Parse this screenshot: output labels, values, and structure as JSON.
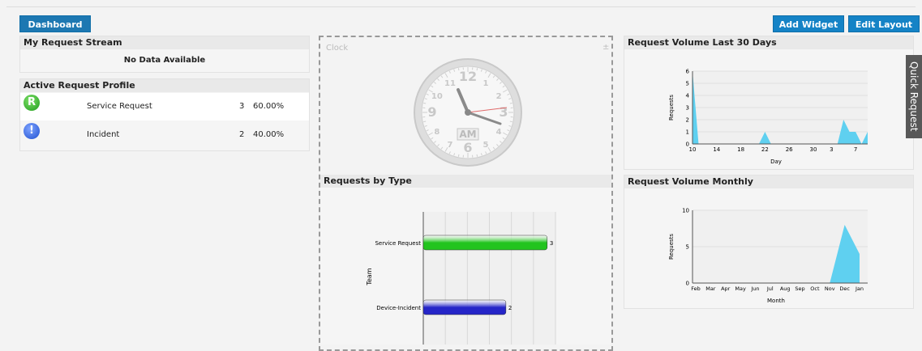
{
  "toolbar": {
    "dashboard": "Dashboard",
    "add_widget": "Add Widget",
    "edit_layout": "Edit Layout"
  },
  "quick_request": "Quick Request",
  "stream": {
    "title": "My Request Stream",
    "empty": "No Data Available"
  },
  "profile": {
    "title": "Active Request Profile",
    "rows": [
      {
        "icon": "R",
        "name": "Service Request",
        "count": "3",
        "percent": "60.00%"
      },
      {
        "icon": "!",
        "name": "Incident",
        "count": "2",
        "percent": "40.00%"
      }
    ]
  },
  "clock": {
    "title": "Clock",
    "ampm": "AM",
    "numerals": [
      "12",
      "1",
      "2",
      "3",
      "4",
      "5",
      "6",
      "7",
      "8",
      "9",
      "10",
      "11"
    ]
  },
  "by_type": {
    "title": "Requests by Type"
  },
  "vol30": {
    "title": "Request Volume Last 30 Days"
  },
  "monthly": {
    "title": "Request Volume Monthly"
  },
  "chart_data": [
    {
      "type": "bar",
      "title": "Requests by Type",
      "ylabel": "Team",
      "categories": [
        "Service Request",
        "Device-Incident"
      ],
      "values": [
        3,
        2
      ],
      "colors": [
        "#22c41e",
        "#2525c8"
      ]
    },
    {
      "type": "area",
      "title": "Request Volume Last 30 Days",
      "xlabel": "Day",
      "ylabel": "Requests",
      "x_ticks": [
        "10",
        "14",
        "18",
        "22",
        "26",
        "30",
        "3",
        "7"
      ],
      "y_ticks": [
        "0",
        "1",
        "2",
        "3",
        "4",
        "5",
        "6"
      ],
      "ylim": [
        0,
        6
      ],
      "days": [
        "10",
        "11",
        "12",
        "13",
        "14",
        "15",
        "16",
        "17",
        "18",
        "19",
        "20",
        "21",
        "22",
        "23",
        "24",
        "25",
        "26",
        "27",
        "28",
        "29",
        "30",
        "1",
        "2",
        "3",
        "4",
        "5",
        "6",
        "7",
        "8",
        "9"
      ],
      "values": [
        6,
        0,
        0,
        0,
        0,
        0,
        0,
        0,
        0,
        0,
        0,
        0,
        1,
        0,
        0,
        0,
        0,
        0,
        0,
        0,
        0,
        0,
        0,
        0,
        0,
        2,
        1,
        1,
        0,
        1
      ],
      "color": "#5fd0f0"
    },
    {
      "type": "area",
      "title": "Request Volume Monthly",
      "xlabel": "Month",
      "ylabel": "Requests",
      "categories": [
        "Feb",
        "Mar",
        "Apr",
        "May",
        "Jun",
        "Jul",
        "Aug",
        "Sep",
        "Oct",
        "Nov",
        "Dec",
        "Jan"
      ],
      "values": [
        0,
        0,
        0,
        0,
        0,
        0,
        0,
        0,
        0,
        0,
        8,
        4
      ],
      "y_ticks": [
        "0",
        "5",
        "10"
      ],
      "ylim": [
        0,
        10
      ],
      "color": "#5fd0f0"
    }
  ]
}
